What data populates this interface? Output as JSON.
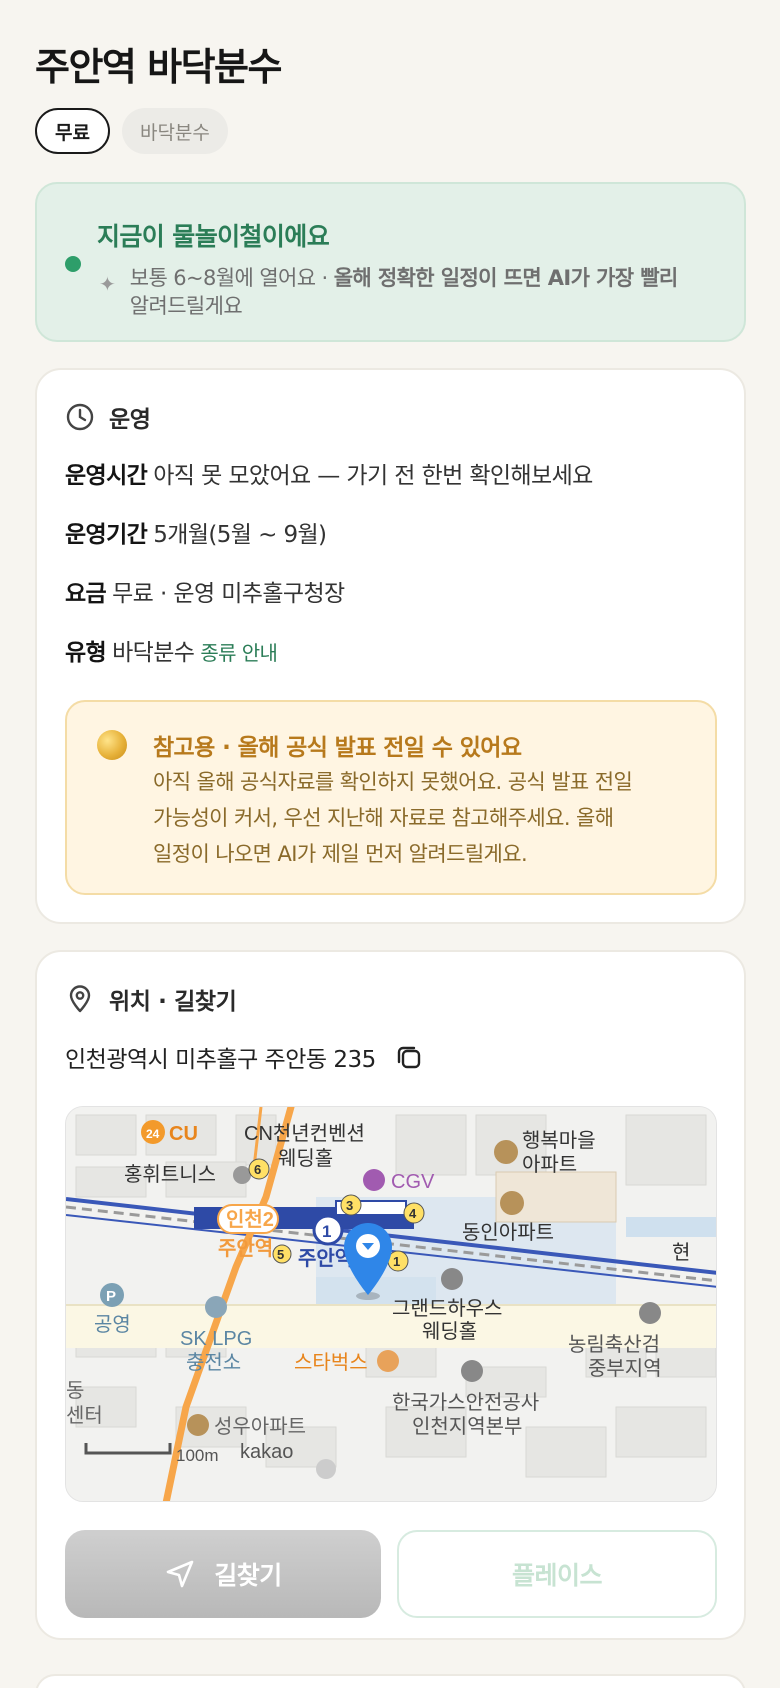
{
  "title": "주안역 바닥분수",
  "chips": {
    "price": "무료",
    "type": "바닥분수"
  },
  "status_banner": {
    "title": "지금이 물놀이철이에요",
    "sub_plain": "보통 6~8월에 열어요 · ",
    "sub_bold": "올해 정확한 일정이 뜨면 AI가 가장 빨리",
    "sub_line2": "알려드릴게요",
    "accent_color": "#2e9e6a"
  },
  "operation": {
    "header": "운영",
    "hours_label": "운영시간",
    "hours_value": "아직 못 모았어요 — 가기 전 한번 확인해보세요",
    "period_label": "운영기간",
    "period_value": "5개월(5월 ~ 9월)",
    "fee_label": "요금",
    "fee_value": "무료 · 운영 미추홀구청장",
    "type_label": "유형",
    "type_value": "바닥분수",
    "type_link": "종류 안내"
  },
  "notice": {
    "title": "참고용 · 올해 공식 발표 전일 수 있어요",
    "line1": "아직 올해 공식자료를 확인하지 못했어요. 공식 발표 전일",
    "line2": "가능성이 커서, 우선 지난해 자료로 참고해주세요. 올해",
    "line3": "일정이 나오면 AI가 제일 먼저 알려드릴게요."
  },
  "location": {
    "header": "위치 · 길찾기",
    "address": "인천광역시 미추홀구 주안동 235"
  },
  "map": {
    "labels": {
      "cu": "CU",
      "convention1": "CN천년컨벤션",
      "convention2": "웨딩홀",
      "tennis": "홍휘트니스",
      "cgv": "CGV",
      "apt_happy1": "행복마을",
      "apt_happy2": "아파트",
      "apt_dongin": "동인아파트",
      "incheon2": "인천2",
      "juan_orange": "주안역",
      "juan_blue": "주안역",
      "park_p": "P",
      "gongyeong": "공영",
      "sk1": "SK LPG",
      "sk2": "충전소",
      "grand1": "그랜드하우스",
      "grand2": "웨딩홀",
      "starbucks": "스타벅스",
      "gas1": "한국가스안전공사",
      "gas2": "인천지역본부",
      "nonglim1": "농림축산검",
      "nonglim2": "중부지역",
      "seongwoo": "성우아파트",
      "dong": "동",
      "center": "센터",
      "hyeon": "현",
      "scale": "100m",
      "kakao": "kakao",
      "exit1": "1",
      "exit3": "3",
      "exit4": "4",
      "exit5": "5",
      "exit6": "6",
      "exit1b": "1",
      "line1": "1"
    }
  },
  "buttons": {
    "navigate": "길찾기",
    "place": "플레이스"
  }
}
